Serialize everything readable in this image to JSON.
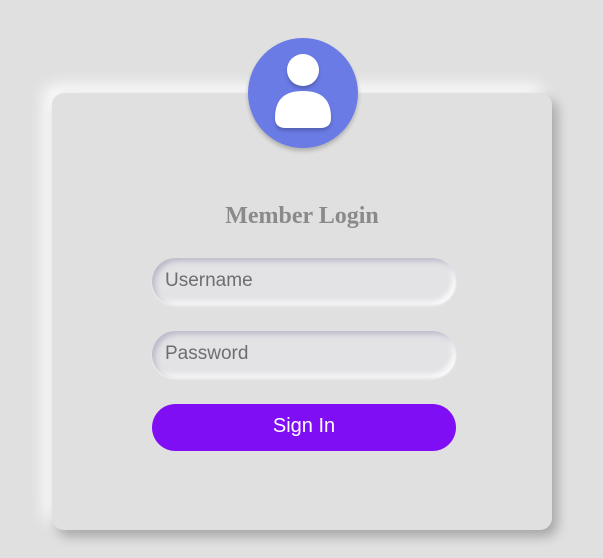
{
  "login": {
    "title": "Member Login",
    "username_placeholder": "Username",
    "username_value": "",
    "password_placeholder": "Password",
    "password_value": "",
    "signin_label": "Sign In"
  },
  "icons": {
    "avatar": "user-icon"
  },
  "colors": {
    "background": "#e0e0e0",
    "avatar": "#6a7be6",
    "button": "#800ef5",
    "button_text": "#ffffff",
    "title": "#8a8a8a"
  }
}
